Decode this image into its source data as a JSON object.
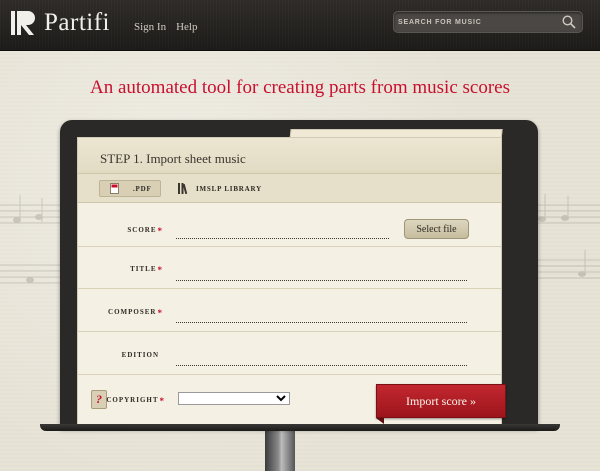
{
  "header": {
    "app_name": "Partifi",
    "nav": [
      "Sign In",
      "Help"
    ],
    "search_placeholder": "SEARCH FOR MUSIC"
  },
  "headline": "An automated tool for creating parts from music scores",
  "step": {
    "title": "STEP 1.  Import sheet music",
    "sources": [
      ".PDF",
      "IMSLP LIBRARY"
    ],
    "selected_source": ".PDF"
  },
  "form": {
    "fields": [
      {
        "label": "SCORE",
        "required": "*"
      },
      {
        "label": "TITLE",
        "required": "*"
      },
      {
        "label": "COMPOSER",
        "required": "*"
      },
      {
        "label": "EDITION",
        "required": ""
      },
      {
        "label": "COPYRIGHT",
        "required": "*"
      }
    ],
    "select_file_label": "Select file",
    "help_label": "?",
    "copyright_value": "",
    "import_label": "Import score »"
  },
  "colors": {
    "accent": "#c8102e",
    "header": "#2a2725",
    "paper": "#f4f0e3"
  }
}
